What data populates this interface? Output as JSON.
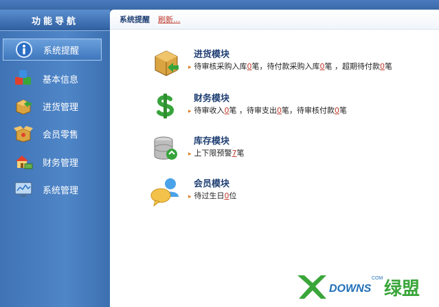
{
  "sidebar": {
    "title": "功能导航",
    "items": [
      {
        "label": "系统提醒",
        "icon": "info-icon"
      },
      {
        "label": "基本信息",
        "icon": "cubes-icon"
      },
      {
        "label": "进货管理",
        "icon": "box-in-icon"
      },
      {
        "label": "会员零售",
        "icon": "box-open-icon"
      },
      {
        "label": "财务管理",
        "icon": "house-money-icon"
      },
      {
        "label": "系统管理",
        "icon": "monitor-chart-icon"
      }
    ]
  },
  "header": {
    "breadcrumb": "系统提醒",
    "refresh_label": "刷新..."
  },
  "modules": [
    {
      "title": "进货模块",
      "parts": [
        {
          "t": "待审核采购入库"
        },
        {
          "n": "0"
        },
        {
          "t": "笔，待付款采购入库"
        },
        {
          "n": "0"
        },
        {
          "t": "笔 ，超期待付款"
        },
        {
          "n": "0"
        },
        {
          "t": "笔"
        }
      ]
    },
    {
      "title": "财务模块",
      "parts": [
        {
          "t": "待审收入"
        },
        {
          "n": "0"
        },
        {
          "t": "笔 ，待审支出"
        },
        {
          "n": "0"
        },
        {
          "t": "笔，待审核付款"
        },
        {
          "n": "0"
        },
        {
          "t": "笔"
        }
      ]
    },
    {
      "title": "库存模块",
      "parts": [
        {
          "t": "上下限预警"
        },
        {
          "n": "7"
        },
        {
          "t": "笔"
        }
      ]
    },
    {
      "title": "会员模块",
      "parts": [
        {
          "t": "待过生日"
        },
        {
          "n": "0"
        },
        {
          "t": "位"
        }
      ]
    }
  ],
  "watermark": {
    "text": "XDOWNS绿盟",
    "small": "COM"
  },
  "colors": {
    "sidebar": "#4a7fc0",
    "accent_red": "#c0392b",
    "title_blue": "#1f3f73"
  }
}
